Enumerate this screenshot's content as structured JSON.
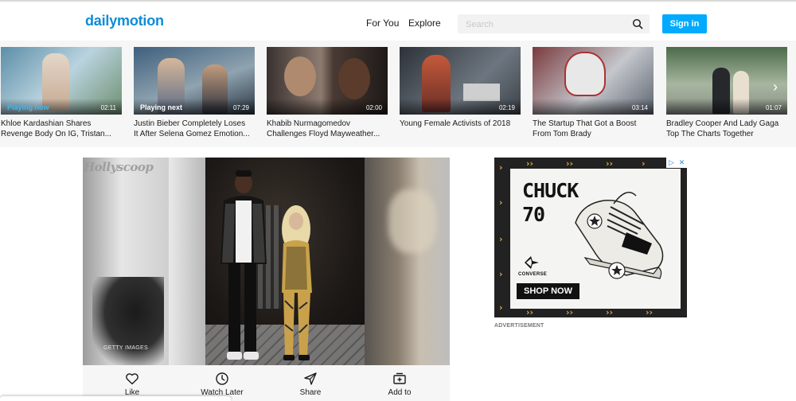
{
  "header": {
    "logo": "dailymotion",
    "nav": [
      "For You",
      "Explore"
    ],
    "search_placeholder": "Search",
    "signin_label": "Sign in"
  },
  "carousel": {
    "items": [
      {
        "badge": "Playing now",
        "duration": "02:11",
        "title_line1": "Khloe Kardashian Shares",
        "title_line2": "Revenge Body On IG, Tristan...",
        "color_a": "#5c8ea8",
        "color_b": "#b9d3de"
      },
      {
        "badge": "Playing next",
        "duration": "07:29",
        "title_line1": "Justin Bieber Completely Loses",
        "title_line2": "It After Selena Gomez Emotion...",
        "color_a": "#3e5f7d",
        "color_b": "#8fa3b0"
      },
      {
        "badge": "",
        "duration": "02:00",
        "title_line1": "Khabib Nurmagomedov",
        "title_line2": "Challenges Floyd Mayweather...",
        "color_a": "#3a3230",
        "color_b": "#8d7b70"
      },
      {
        "badge": "",
        "duration": "02:19",
        "title_line1": "Young Female Activists of 2018",
        "title_line2": "",
        "color_a": "#2d3238",
        "color_b": "#6d7680"
      },
      {
        "badge": "",
        "duration": "03:14",
        "title_line1": "The Startup That Got a Boost",
        "title_line2": "From Tom Brady",
        "color_a": "#7a3a3e",
        "color_b": "#c4c7cc"
      },
      {
        "badge": "",
        "duration": "01:07",
        "title_line1": "Bradley Cooper And Lady Gaga",
        "title_line2": "Top The Charts Together",
        "color_a": "#4c6a4a",
        "color_b": "#a7b6a0"
      }
    ]
  },
  "player": {
    "watermark": "Hollyscoop",
    "credit": "GETTY IMAGES"
  },
  "actions": [
    "Like",
    "Watch Later",
    "Share",
    "Add to"
  ],
  "ad": {
    "headline_1": "CHUCK",
    "headline_2": "70",
    "brand": "CONVERSE",
    "cta": "SHOP NOW",
    "label": "ADVERTISEMENT"
  },
  "colors": {
    "brand": "#0d8cd6",
    "signin": "#00aaff",
    "playing_now": "#3fb7f1",
    "ad_accent": "#d7a64a"
  }
}
